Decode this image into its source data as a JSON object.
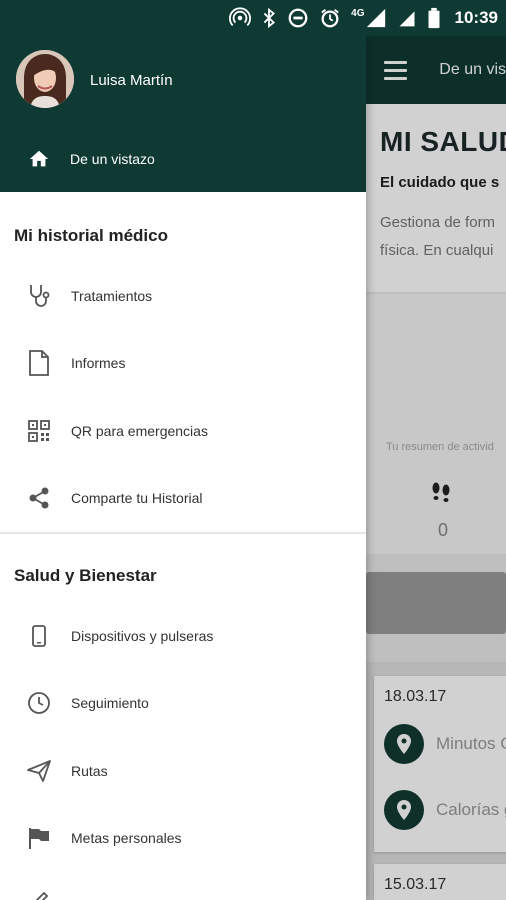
{
  "status_bar": {
    "network": "4G",
    "time": "10:39"
  },
  "colors": {
    "primary_dark": "#0f3a34",
    "background": "#ffffff",
    "text_dark": "#222222",
    "icon_gray": "#555555"
  },
  "drawer": {
    "user_name": "Luisa Martín",
    "home_label": "De un vistazo",
    "sections": [
      {
        "title": "Mi historial médico",
        "items": [
          {
            "label": "Tratamientos",
            "icon": "stethoscope-icon"
          },
          {
            "label": "Informes",
            "icon": "document-icon"
          },
          {
            "label": "QR para emergencias",
            "icon": "qr-code-icon"
          },
          {
            "label": "Comparte tu Historial",
            "icon": "share-icon"
          }
        ]
      },
      {
        "title": "Salud y Bienestar",
        "items": [
          {
            "label": "Dispositivos y pulseras",
            "icon": "phone-device-icon"
          },
          {
            "label": "Seguimiento",
            "icon": "clock-icon"
          },
          {
            "label": "Rutas",
            "icon": "paper-plane-icon"
          },
          {
            "label": "Metas personales",
            "icon": "flag-icon"
          }
        ]
      }
    ]
  },
  "background_app": {
    "appbar_title": "De un vis",
    "hero_title": "MI SALUD",
    "hero_subtitle": "El cuidado que s",
    "hero_desc_1": "Gestiona de form",
    "hero_desc_2": "física. En cualqui",
    "summary_caption": "Tu resumen de activid",
    "steps_value": "0",
    "cards": [
      {
        "date": "18.03.17",
        "rows": [
          "Minutos C",
          "Calorías g"
        ]
      },
      {
        "date": "15.03.17",
        "rows": []
      }
    ]
  }
}
